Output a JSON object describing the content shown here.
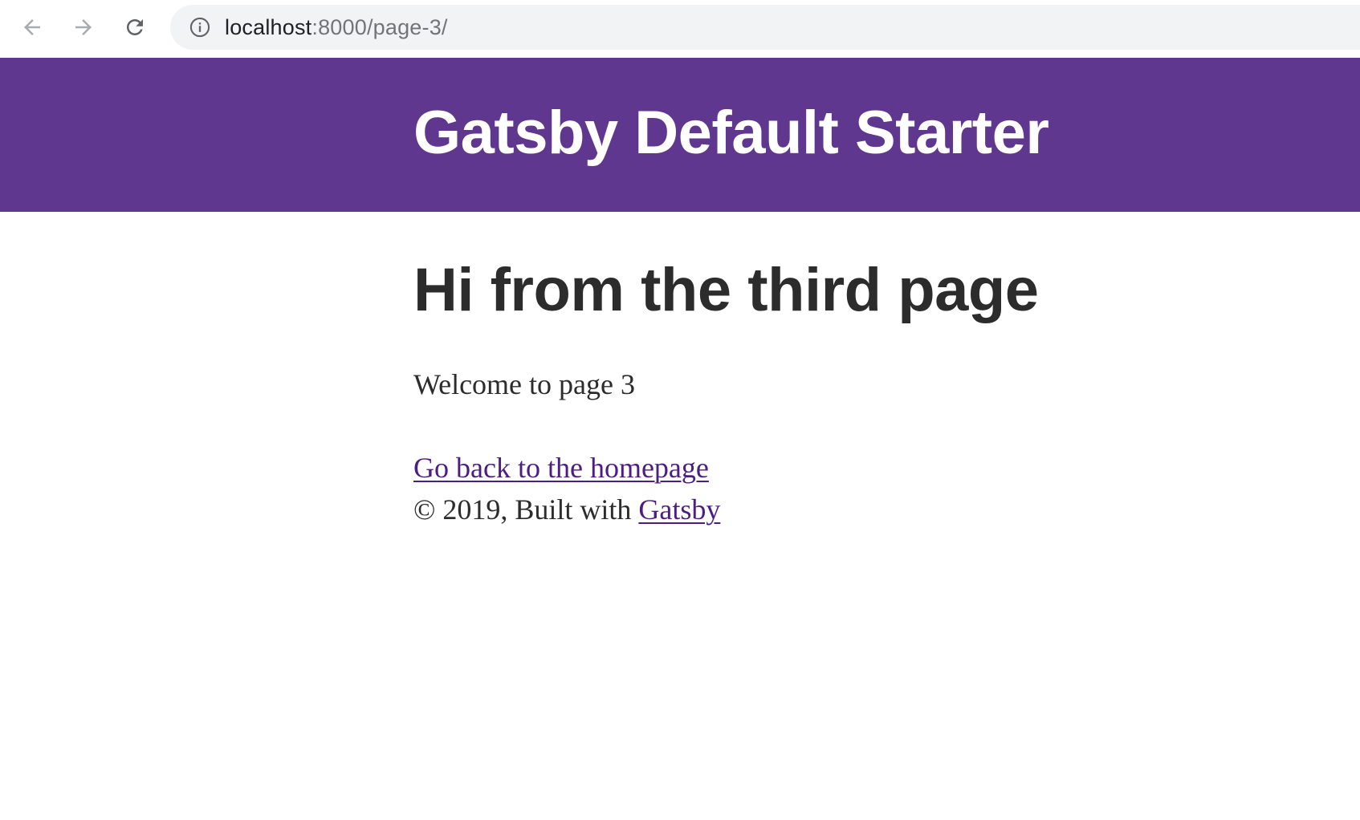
{
  "browser": {
    "url_host": "localhost",
    "url_path": ":8000/page-3/",
    "icons": {
      "back": "arrow-left-icon",
      "forward": "arrow-right-icon",
      "reload": "reload-icon",
      "site_info": "info-circle-icon"
    }
  },
  "header": {
    "title": "Gatsby Default Starter",
    "background_color": "#5f378f",
    "text_color": "#ffffff"
  },
  "main": {
    "heading": "Hi from the third page",
    "welcome": "Welcome to page 3",
    "home_link_label": "Go back to the homepage",
    "link_color": "#4c1d82"
  },
  "footer": {
    "prefix": "© 2019, Built with",
    "gatsby_link_label": "Gatsby"
  }
}
